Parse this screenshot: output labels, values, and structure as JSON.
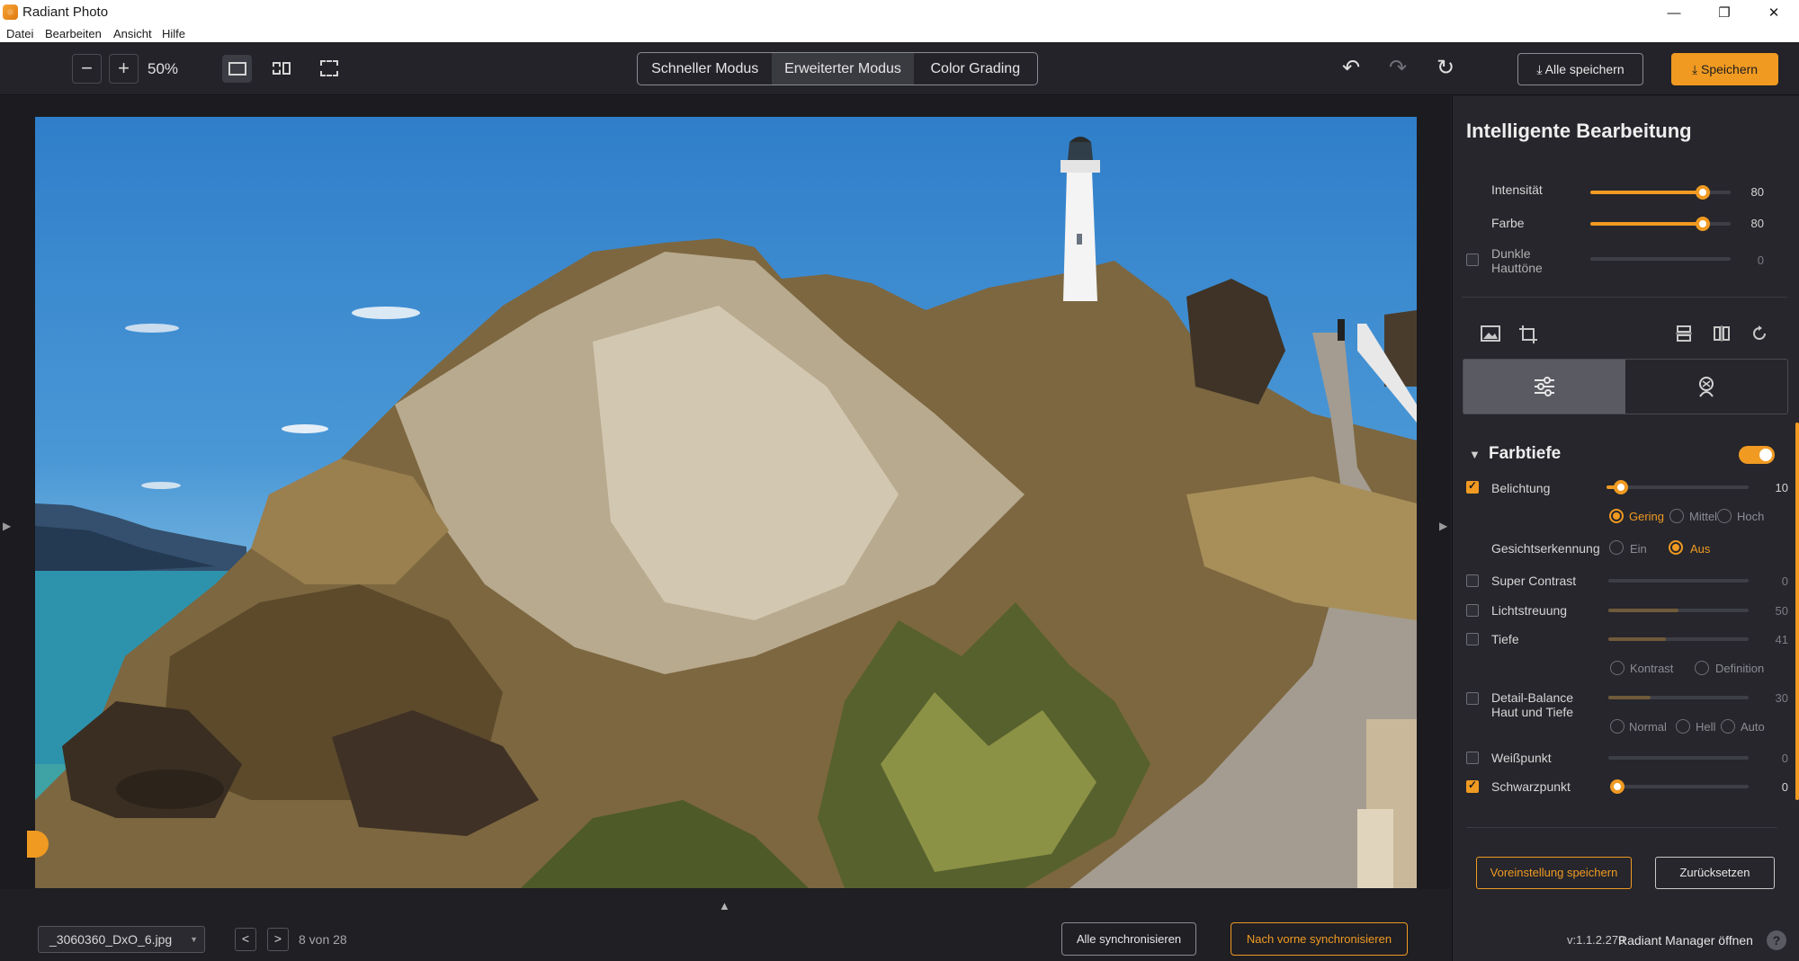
{
  "app": {
    "title": "Radiant Photo"
  },
  "window_controls": {
    "minimize": "—",
    "maximize": "❐",
    "close": "✕"
  },
  "menu": [
    "Datei",
    "Bearbeiten",
    "Ansicht",
    "Hilfe"
  ],
  "toolbar": {
    "zoom_out": "−",
    "zoom_in": "+",
    "zoom": "50%",
    "view_modes": [
      "single-view-icon",
      "split-view-icon",
      "crop-view-icon"
    ],
    "modes": [
      {
        "label": "Schneller Modus",
        "active": false
      },
      {
        "label": "Erweiterter Modus",
        "active": true
      },
      {
        "label": "Color Grading",
        "active": false
      }
    ],
    "undo": "↶",
    "redo": "↷",
    "reset": "↻",
    "save_all": "⤓ Alle speichern",
    "save": "⤓ Speichern"
  },
  "canvas": {
    "left_arrow": "▶",
    "right_arrow": "▶"
  },
  "bottom": {
    "file_name": "_3060360_DxO_6.jpg",
    "prev": "<",
    "next": ">",
    "page_count": "8 von 28",
    "expand_arrow": "▲",
    "sync_all": "Alle synchronisieren",
    "sync_forward": "Nach vorne synchronisieren"
  },
  "panel": {
    "title": "Intelligente Bearbeitung",
    "smart": [
      {
        "label": "Intensität",
        "value": "80",
        "fraction": 0.8,
        "checkbox": false
      },
      {
        "label": "Farbe",
        "value": "80",
        "fraction": 0.8,
        "checkbox": false
      },
      {
        "label": "Dunkle\nHauttöne",
        "value": "0",
        "fraction": 0.0,
        "checkbox": true,
        "checked": false
      }
    ],
    "tools": [
      "image-icon",
      "crop-icon",
      "flip-vertical-icon",
      "flip-horizontal-icon",
      "rotate-icon"
    ],
    "tabs": [
      {
        "icon": "sliders-icon",
        "active": true
      },
      {
        "icon": "face-retouch-icon",
        "active": false
      }
    ],
    "section": {
      "title": "Farbtiefe",
      "enabled": true
    },
    "exposure": {
      "label": "Belichtung",
      "value": "10",
      "fraction": 0.1,
      "checked": true
    },
    "exposure_levels": [
      {
        "label": "Gering",
        "selected": true
      },
      {
        "label": "Mittel",
        "selected": false
      },
      {
        "label": "Hoch",
        "selected": false
      }
    ],
    "face_detection": {
      "label": "Gesichtserkennung",
      "options": [
        {
          "label": "Ein",
          "selected": false
        },
        {
          "label": "Aus",
          "selected": true
        }
      ]
    },
    "adjustments": [
      {
        "label": "Super Contrast",
        "value": "0",
        "fraction": 0.0,
        "checked": false
      },
      {
        "label": "Lichtstreuung",
        "value": "50",
        "fraction": 0.5,
        "checked": false
      },
      {
        "label": "Tiefe",
        "value": "41",
        "fraction": 0.41,
        "checked": false
      }
    ],
    "depth_modes": [
      {
        "label": "Kontrast",
        "selected": false
      },
      {
        "label": "Definition",
        "selected": false
      }
    ],
    "detail_balance": {
      "label": "Detail-Balance\nHaut und Tiefe",
      "value": "30",
      "fraction": 0.3,
      "checked": false
    },
    "detail_modes": [
      {
        "label": "Normal",
        "selected": false
      },
      {
        "label": "Hell",
        "selected": false
      },
      {
        "label": "Auto",
        "selected": false
      }
    ],
    "points": [
      {
        "label": "Weißpunkt",
        "value": "0",
        "fraction": 0.0,
        "checked": false
      },
      {
        "label": "Schwarzpunkt",
        "value": "0",
        "fraction": 0.0,
        "checked": true
      }
    ],
    "save_preset": "Voreinstellung speichern",
    "reset": "Zurücksetzen",
    "version": "v:1.1.2.279",
    "manager_link": "Radiant Manager öffnen",
    "help": "?"
  },
  "colors": {
    "accent": "#f09a22",
    "background": "#1f1f24",
    "panel": "#26262c"
  }
}
